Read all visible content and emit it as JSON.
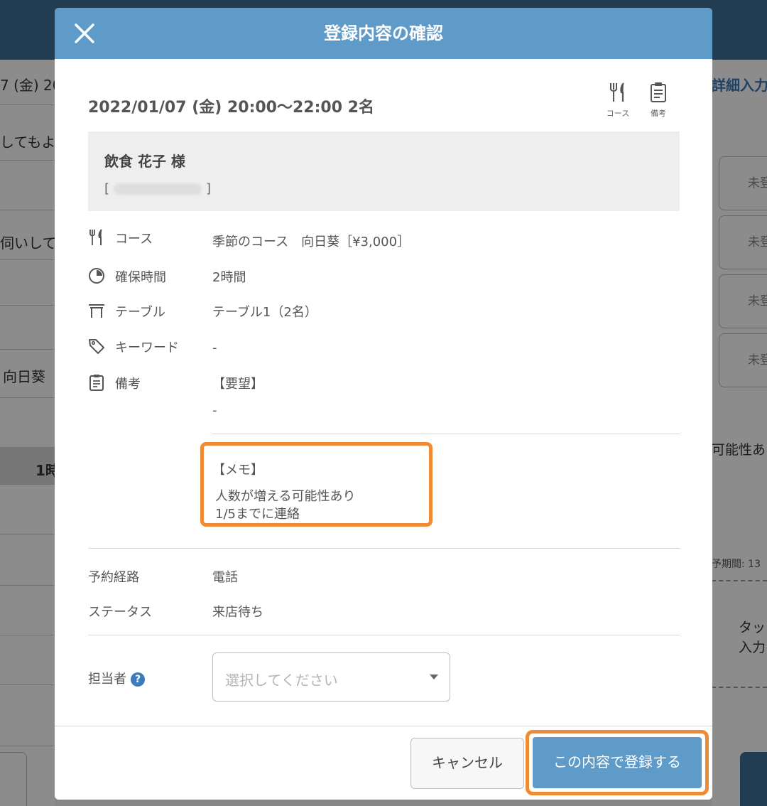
{
  "background": {
    "left_fragments": [
      "7 (金) 20",
      "してもよ",
      "伺いして",
      "向日葵",
      "1時"
    ],
    "right_link": "詳細入力",
    "right_slot_label": "未登",
    "right_text_1": "可能性あり",
    "right_period": "予期間: 13",
    "right_tap_1": "タッ",
    "right_tap_2": "入力"
  },
  "modal": {
    "title": "登録内容の確認",
    "datetime": "2022/01/07 (金) 20:00～22:00 2名",
    "header_icons": [
      {
        "icon": "fork-knife-icon",
        "caption": "コース"
      },
      {
        "icon": "memo-icon",
        "caption": "備考"
      }
    ],
    "guest": {
      "name": "飲食 花子 様",
      "phone_open": "[",
      "phone_close": "]"
    },
    "details": {
      "course": {
        "label": "コース",
        "value": "季節のコース　向日葵［¥3,000］"
      },
      "duration": {
        "label": "確保時間",
        "value": "2時間"
      },
      "table": {
        "label": "テーブル",
        "value": "テーブル1（2名）"
      },
      "keyword": {
        "label": "キーワード",
        "value": "-"
      },
      "notes": {
        "label": "備考",
        "request_title": "【要望】",
        "request_value": "-"
      }
    },
    "memo": {
      "title": "【メモ】",
      "line1": "人数が増える可能性あり",
      "line2": "1/5までに連絡"
    },
    "route": {
      "label": "予約経路",
      "value": "電話"
    },
    "status": {
      "label": "ステータス",
      "value": "来店待ち"
    },
    "staff": {
      "label": "担当者",
      "help": "?",
      "placeholder": "選択してください"
    },
    "buttons": {
      "cancel": "キャンセル",
      "confirm": "この内容で登録する"
    }
  }
}
